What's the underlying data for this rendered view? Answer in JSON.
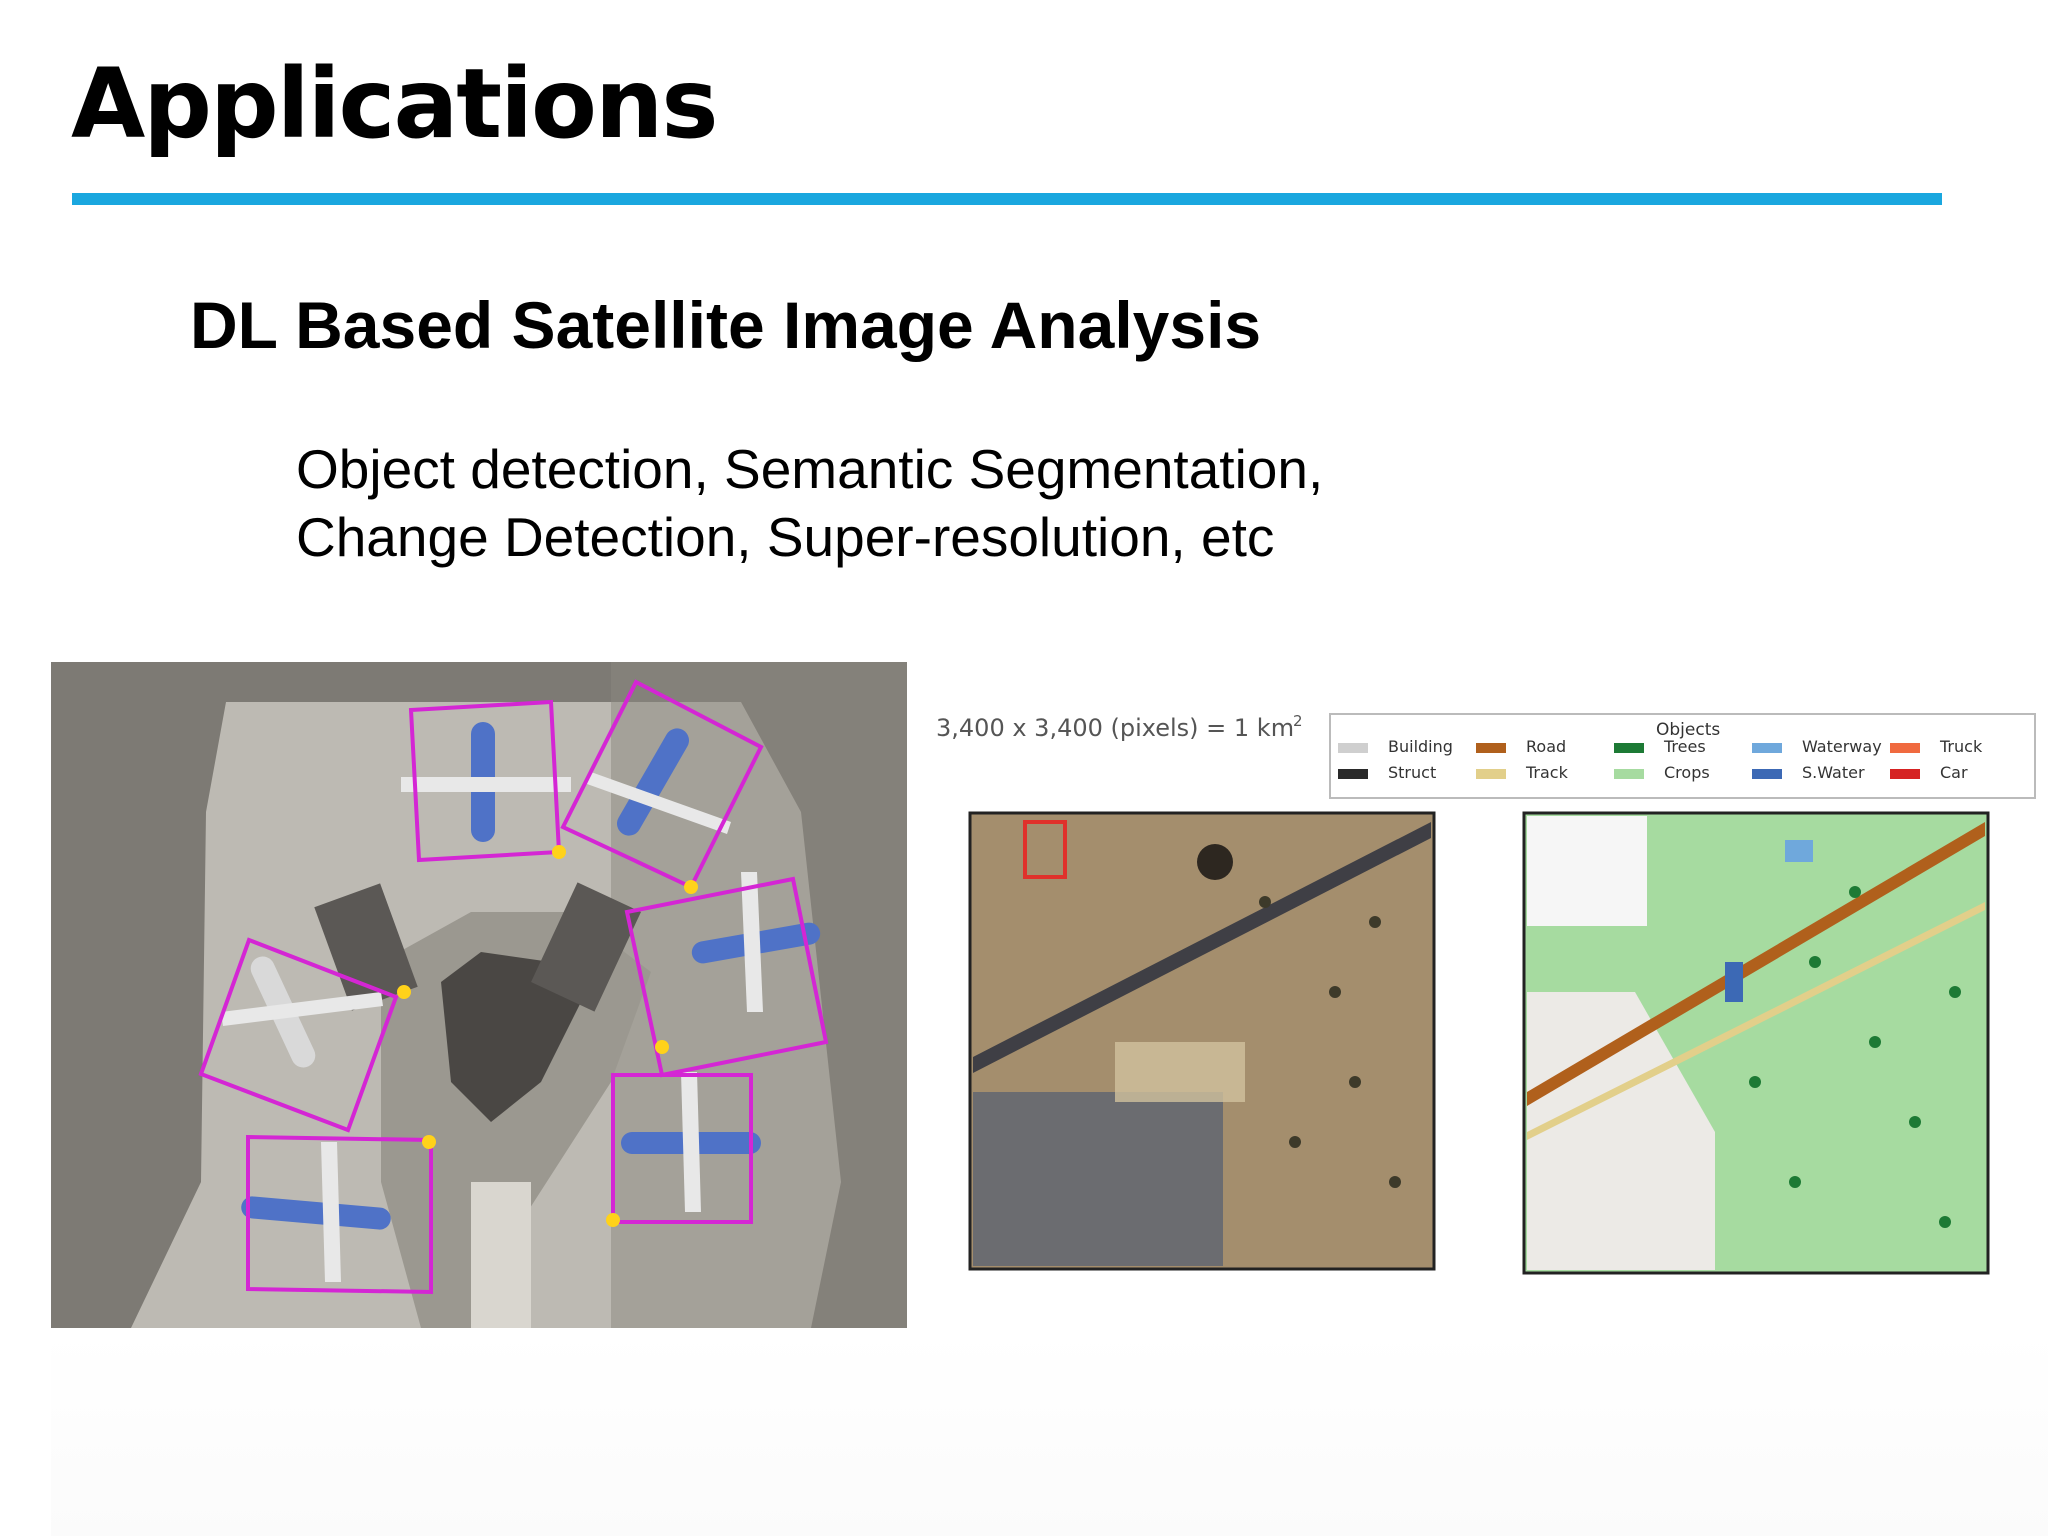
{
  "slide": {
    "title": "Applications",
    "accent_color": "#1aa7df",
    "subtitle": "DL Based Satellite Image Analysis",
    "body_lines": [
      "Object detection, Semantic Segmentation,",
      "Change Detection, Super-resolution, etc"
    ]
  },
  "figure_left": {
    "description_icon": "airport-aerial-object-detection-image",
    "box_color": "#d426d4",
    "marker_color": "#ffd21a"
  },
  "figure_right": {
    "scale_text": "3,400 x 3,400 (pixels) = 1 km",
    "scale_superscript": "2",
    "legend": {
      "title": "Objects",
      "items": [
        {
          "label": "Building",
          "color": "#cfcfcf"
        },
        {
          "label": "Struct",
          "color": "#2a2a2a"
        },
        {
          "label": "Road",
          "color": "#b0601c"
        },
        {
          "label": "Track",
          "color": "#e2cf8a"
        },
        {
          "label": "Trees",
          "color": "#1d7a35"
        },
        {
          "label": "Crops",
          "color": "#a6dba0"
        },
        {
          "label": "Waterway",
          "color": "#6fa8dc"
        },
        {
          "label": "S.Water",
          "color": "#3c69b5"
        },
        {
          "label": "Truck",
          "color": "#f06a3f"
        },
        {
          "label": "Car",
          "color": "#d62222"
        }
      ]
    }
  }
}
